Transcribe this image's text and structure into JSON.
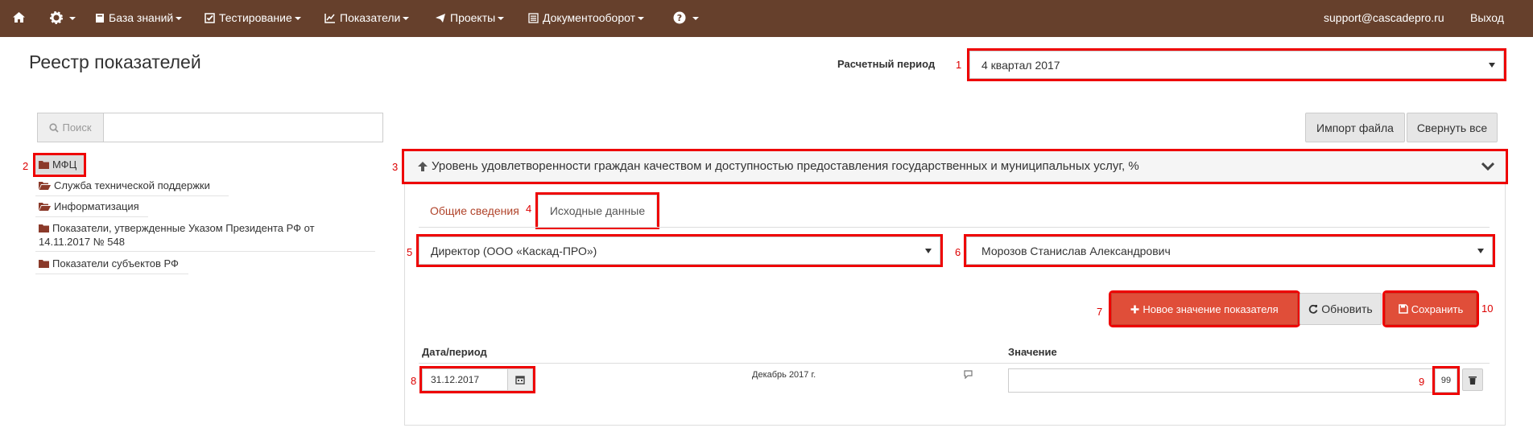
{
  "navbar": {
    "menu": [
      "База знаний",
      "Тестирование",
      "Показатели",
      "Проекты",
      "Документооборот"
    ],
    "user_email": "support@cascadepro.ru",
    "logout": "Выход"
  },
  "page": {
    "title": "Реестр показателей",
    "period_label": "Расчетный период",
    "period_value": "4 квартал 2017"
  },
  "search": {
    "label": "Поиск",
    "value": ""
  },
  "buttons": {
    "import": "Импорт файла",
    "collapse_all": "Свернуть все",
    "new_value": "Новое значение показателя",
    "refresh": "Обновить",
    "save": "Сохранить"
  },
  "tree": {
    "items": [
      {
        "label": "МФЦ"
      },
      {
        "label": "Служба технической поддержки"
      },
      {
        "label": "Информатизация"
      },
      {
        "label": "Показатели, утвержденные Указом Президента РФ от",
        "label2": "14.11.2017 № 548"
      },
      {
        "label": "Показатели субъектов РФ"
      }
    ]
  },
  "indicator": {
    "title": "Уровень удовлетворенности граждан качеством и доступностью предоставления государственных и муниципальных услуг, %"
  },
  "tabs": [
    "Общие сведения",
    "Исходные данные"
  ],
  "selects": {
    "position": "Директор (ООО «Каскад-ПРО»)",
    "person": "Морозов Станислав Александрович"
  },
  "table": {
    "headers": {
      "date": "Дата/период",
      "value": "Значение"
    },
    "rows": [
      {
        "date": "31.12.2017",
        "period_text": "Декабрь 2017 г.",
        "comment": "",
        "value": "99"
      }
    ]
  },
  "callouts": [
    "1",
    "2",
    "3",
    "4",
    "5",
    "6",
    "7",
    "8",
    "9",
    "10"
  ],
  "colors": {
    "navbar": "#66402c",
    "accent": "#e04e39",
    "callout": "#e00000"
  }
}
